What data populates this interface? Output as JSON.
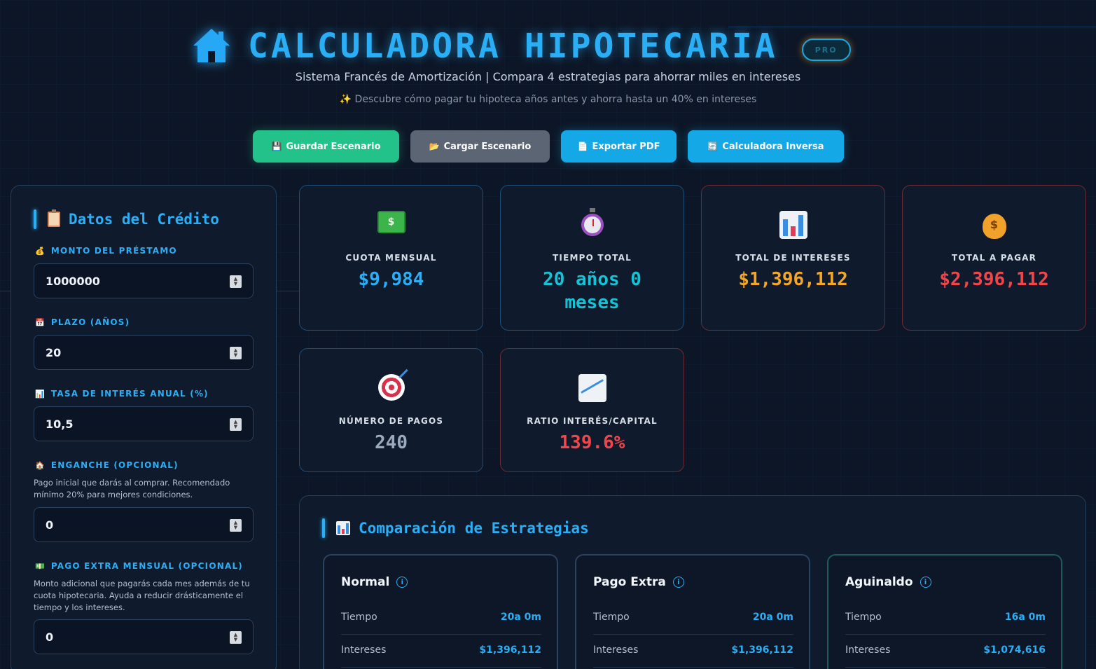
{
  "header": {
    "title": "CALCULADORA HIPOTECARIA",
    "badge": "PRO",
    "subtitle": "Sistema Francés de Amortización | Compara 4 estrategias para ahorrar miles en intereses",
    "tagline": "✨ Descubre cómo pagar tu hipoteca años antes y ahorra hasta un 40% en intereses"
  },
  "actions": {
    "save": "Guardar Escenario",
    "load": "Cargar Escenario",
    "pdf": "Exportar PDF",
    "inverse": "Calculadora Inversa"
  },
  "form": {
    "title": "Datos del Crédito",
    "fields": [
      {
        "label": "MONTO DEL PRÉSTAMO",
        "icon": "money-bag-icon",
        "value": "1000000"
      },
      {
        "label": "PLAZO (AÑOS)",
        "icon": "calendar-icon",
        "value": "20"
      },
      {
        "label": "TASA DE INTERÉS ANUAL (%)",
        "icon": "bar-chart-icon",
        "value": "10,5"
      },
      {
        "label": "ENGANCHE (OPCIONAL)",
        "icon": "house-icon",
        "help": "Pago inicial que darás al comprar. Recomendado mínimo 20% para mejores condiciones.",
        "value": "0"
      },
      {
        "label": "PAGO EXTRA MENSUAL (OPCIONAL)",
        "icon": "cash-icon",
        "help": "Monto adicional que pagarás cada mes además de tu cuota hipotecaria. Ayuda a reducir drásticamente el tiempo y los intereses.",
        "value": "0"
      }
    ]
  },
  "stats": [
    {
      "label": "CUOTA MENSUAL",
      "value": "$9,984",
      "color": "#2aaef6",
      "icon": "money-icon"
    },
    {
      "label": "TIEMPO TOTAL",
      "value": "20 años 0 meses",
      "color": "#14c3d6",
      "icon": "stopwatch-icon"
    },
    {
      "label": "TOTAL DE INTERESES",
      "value": "$1,396,112",
      "color": "#f5a623",
      "icon": "bar-chart-icon"
    },
    {
      "label": "TOTAL A PAGAR",
      "value": "$2,396,112",
      "color": "#f0464b",
      "icon": "money-bag-icon"
    },
    {
      "label": "NÚMERO DE PAGOS",
      "value": "240",
      "color": "#9aa9bd",
      "icon": "target-icon"
    },
    {
      "label": "RATIO INTERÉS/CAPITAL",
      "value": "139.6%",
      "color": "#f0464b",
      "icon": "trend-chart-icon"
    }
  ],
  "comparison": {
    "title": "Comparación de Estrategias",
    "strategies": [
      {
        "name": "Normal",
        "rows": [
          {
            "k": "Tiempo",
            "v": "20a 0m"
          },
          {
            "k": "Intereses",
            "v": "$1,396,112"
          }
        ]
      },
      {
        "name": "Pago Extra",
        "rows": [
          {
            "k": "Tiempo",
            "v": "20a 0m"
          },
          {
            "k": "Intereses",
            "v": "$1,396,112"
          }
        ]
      },
      {
        "name": "Aguinaldo",
        "rows": [
          {
            "k": "Tiempo",
            "v": "16a 0m"
          },
          {
            "k": "Intereses",
            "v": "$1,074,616"
          }
        ]
      }
    ]
  }
}
